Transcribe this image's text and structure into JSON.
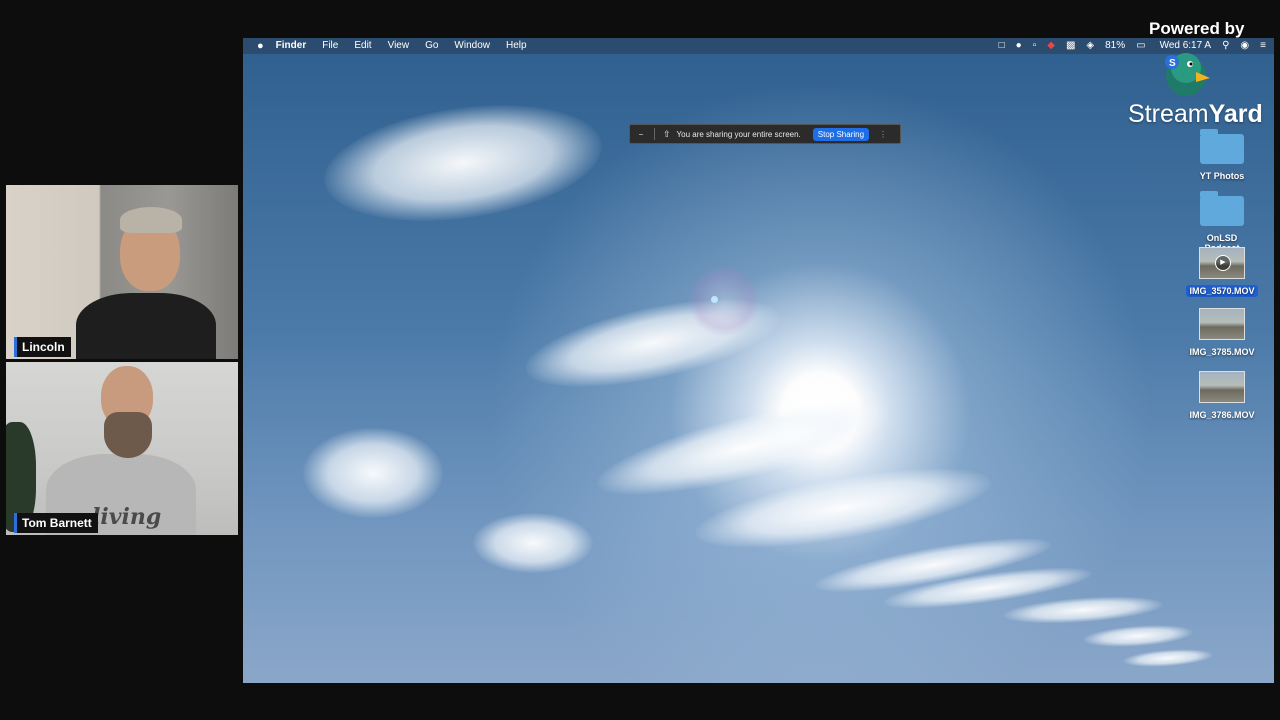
{
  "participants": [
    {
      "name": "Lincoln"
    },
    {
      "name": "Tom Barnett"
    }
  ],
  "tom_shirt_text": "living",
  "menubar": {
    "apple": "",
    "items": [
      "Finder",
      "File",
      "Edit",
      "View",
      "Go",
      "Window",
      "Help"
    ],
    "battery": "81%",
    "clock": "Wed 6:17 A"
  },
  "share_bar": {
    "message": "You are sharing your entire screen.",
    "stop_label": "Stop Sharing"
  },
  "desktop_icons": [
    {
      "label": "YT Photos",
      "kind": "folder"
    },
    {
      "label": "OnLSD Podcast",
      "kind": "folder"
    },
    {
      "label": "IMG_3570.MOV",
      "kind": "video",
      "selected": true
    },
    {
      "label": "IMG_3785.MOV",
      "kind": "video"
    },
    {
      "label": "IMG_3786.MOV",
      "kind": "video"
    }
  ],
  "branding": {
    "powered_by": "Powered by",
    "logo_regular": "Stream",
    "logo_bold": "Yard"
  },
  "colors": {
    "accent": "#1e6ee8",
    "selection": "#1f5fd1",
    "name_tag_bar": "#2a6fdb"
  }
}
